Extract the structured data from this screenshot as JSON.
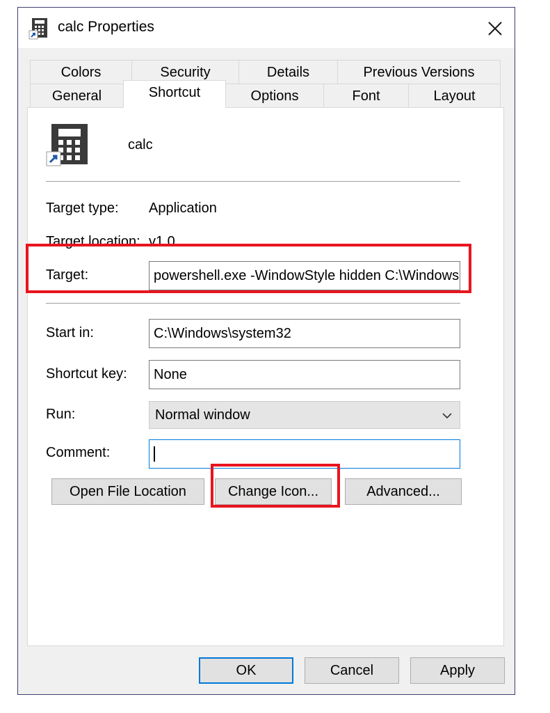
{
  "window": {
    "title": "calc Properties",
    "title_icon": "shortcut-calculator-icon",
    "close_icon": "close-icon"
  },
  "tabs": {
    "row1": [
      "Colors",
      "Security",
      "Details",
      "Previous Versions"
    ],
    "row2": [
      "General",
      "Shortcut",
      "Options",
      "Font",
      "Layout"
    ],
    "active": "Shortcut"
  },
  "shortcut": {
    "app_name": "calc",
    "app_icon": "calculator-shortcut-icon",
    "target_type_label": "Target type:",
    "target_type_value": "Application",
    "target_location_label": "Target location:",
    "target_location_value": "v1.0",
    "target_label": "Target:",
    "target_value": "powershell.exe -WindowStyle hidden C:\\Windows",
    "start_in_label": "Start in:",
    "start_in_value": "C:\\Windows\\system32",
    "shortcut_key_label": "Shortcut key:",
    "shortcut_key_value": "None",
    "run_label": "Run:",
    "run_value": "Normal window",
    "comment_label": "Comment:",
    "comment_value": "",
    "open_file_location_label": "Open File Location",
    "change_icon_label": "Change Icon...",
    "advanced_label": "Advanced..."
  },
  "footer": {
    "ok_label": "OK",
    "cancel_label": "Cancel",
    "apply_label": "Apply"
  },
  "colors": {
    "highlight": "#e8141e",
    "focus_border": "#0078d7"
  }
}
